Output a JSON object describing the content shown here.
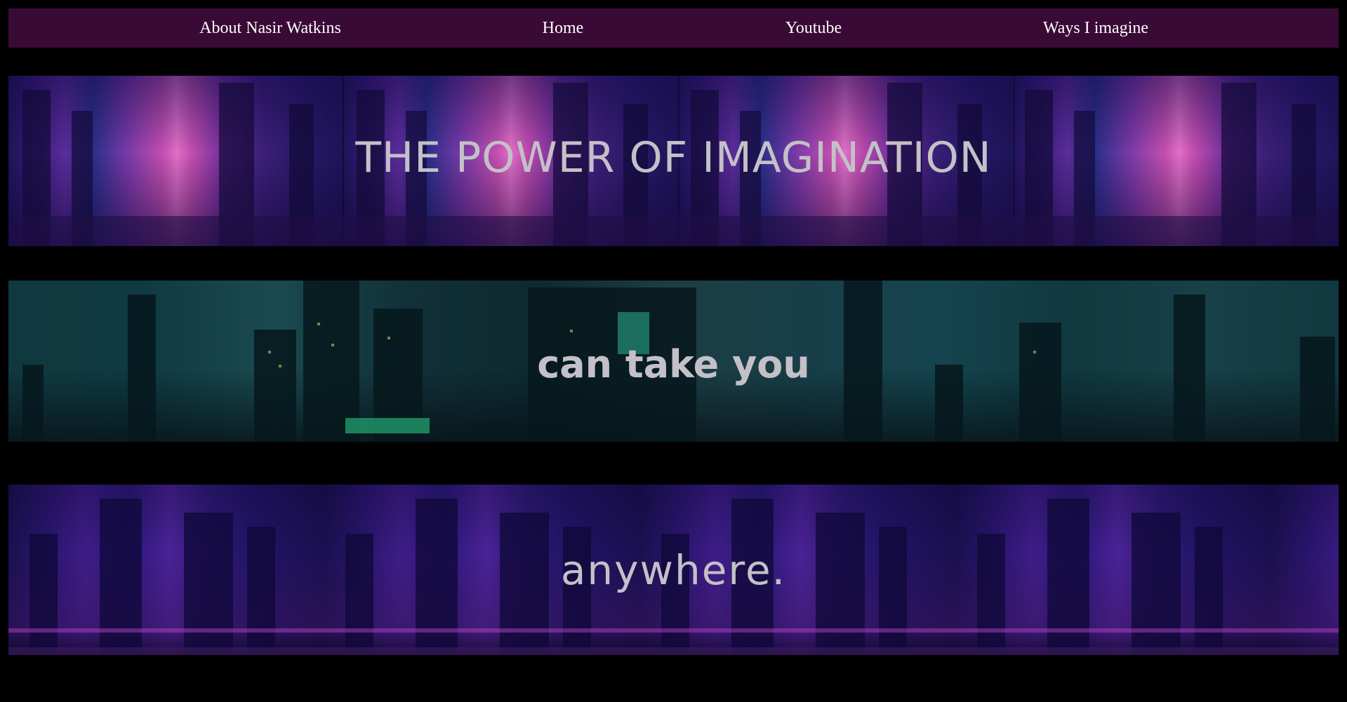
{
  "nav": {
    "items": [
      {
        "label": "About Nasir Watkins"
      },
      {
        "label": "Home"
      },
      {
        "label": "Youtube"
      },
      {
        "label": "Ways I imagine"
      }
    ]
  },
  "banners": [
    {
      "text": "THE POWER OF IMAGINATION"
    },
    {
      "text": "can take you"
    },
    {
      "text": "anywhere."
    }
  ],
  "colors": {
    "page_background": "#000000",
    "nav_background": "#3a0a37",
    "nav_text": "#ffffff",
    "banner_text": "#c4c0c8"
  }
}
